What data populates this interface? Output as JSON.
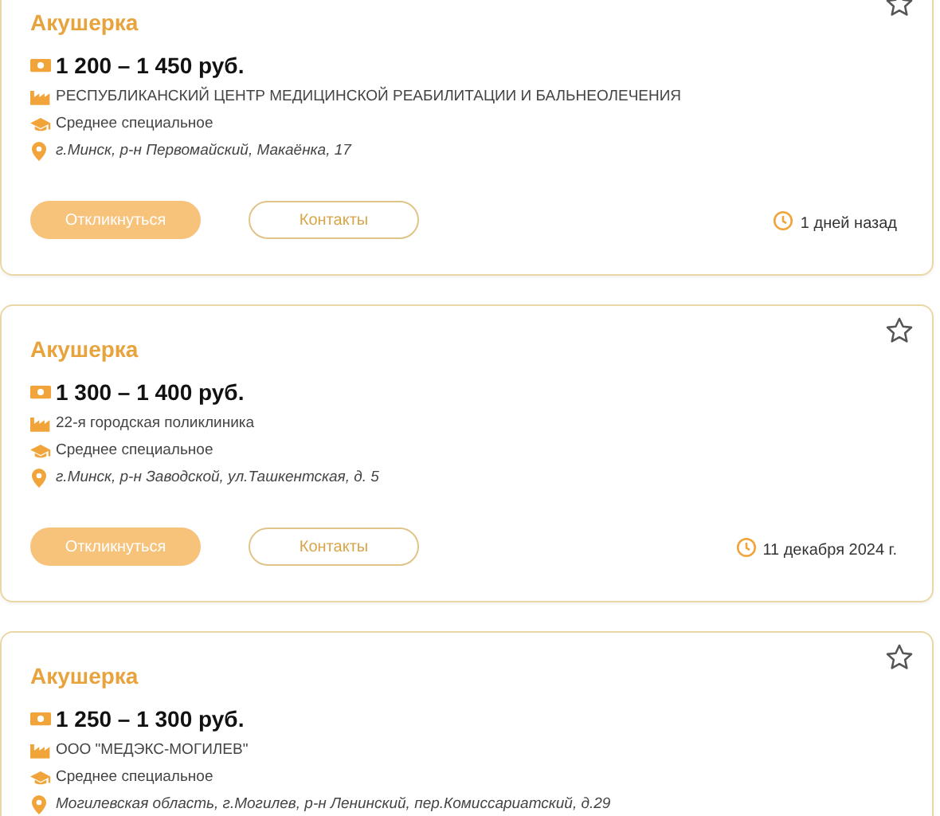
{
  "vacancies": [
    {
      "title": "Акушерка",
      "salary": "1 200 – 1 450 руб.",
      "employer": "РЕСПУБЛИКАНСКИЙ ЦЕНТР МЕДИЦИНСКОЙ РЕАБИЛИТАЦИИ И БАЛЬНЕОЛЕЧЕНИЯ",
      "education": "Среднее специальное",
      "address": "г.Минск, р-н Первомайский, Макаёнка, 17",
      "apply": "Откликнуться",
      "contacts": "Контакты",
      "posted": "1 дней назад"
    },
    {
      "title": "Акушерка",
      "salary": "1 300 – 1 400 руб.",
      "employer": "22-я городская поликлиника",
      "education": "Среднее специальное",
      "address": "г.Минск, р-н Заводской, ул.Ташкентская, д. 5",
      "apply": "Откликнуться",
      "contacts": "Контакты",
      "posted": "11 декабря 2024 г."
    },
    {
      "title": "Акушерка",
      "salary": "1 250 – 1 300 руб.",
      "employer": "ООО \"МЕДЭКС-МОГИЛЕВ\"",
      "education": "Среднее специальное",
      "address": "Могилевская область, г.Могилев, р-н Ленинский, пер.Комиссариатский, д.29"
    }
  ]
}
